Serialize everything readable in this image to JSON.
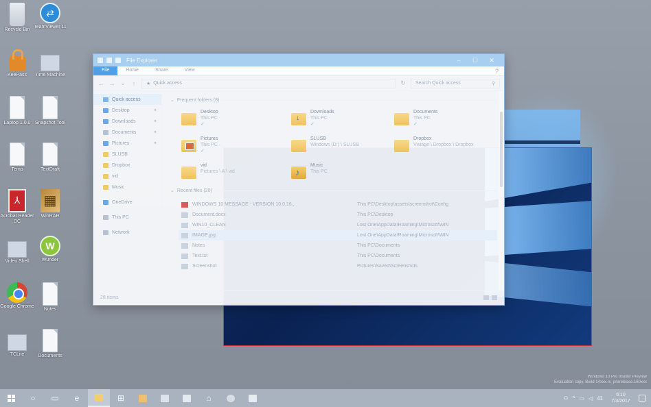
{
  "desktop": {
    "icons": [
      {
        "label": "Recycle Bin",
        "icon": "recycle-bin-icon"
      },
      {
        "label": "TeamViewer 11",
        "icon": "teamviewer-icon"
      },
      {
        "label": "KeePass",
        "icon": "lock-icon"
      },
      {
        "label": "Time Machine",
        "icon": "clock-icon"
      },
      {
        "label": "Laptop 1.0.0",
        "icon": "document-icon"
      },
      {
        "label": "Snapshot Tool",
        "icon": "document-icon"
      },
      {
        "label": "Temp",
        "icon": "document-icon"
      },
      {
        "label": "TextDraft",
        "icon": "document-icon"
      },
      {
        "label": "Acrobat Reader DC",
        "icon": "pdf-icon"
      },
      {
        "label": "WinRAR",
        "icon": "winrar-icon"
      },
      {
        "label": "Video Shell",
        "icon": "video-icon"
      },
      {
        "label": "Wunder",
        "icon": "green-app-icon"
      },
      {
        "label": "Google Chrome",
        "icon": "chrome-icon"
      },
      {
        "label": "Notes",
        "icon": "document-icon"
      },
      {
        "label": "TCLite",
        "icon": "document-icon"
      },
      {
        "label": "Documents",
        "icon": "document-icon"
      }
    ]
  },
  "explorer": {
    "title": "File Explorer",
    "tabs": [
      "File",
      "Home",
      "Share",
      "View"
    ],
    "address": "Quick access",
    "search_placeholder": "Search Quick access",
    "nav": [
      {
        "label": "Quick access",
        "icon": "star-icon",
        "selected": true
      },
      {
        "label": "Desktop",
        "icon": "folder-icon",
        "pinned": true
      },
      {
        "label": "Downloads",
        "icon": "download-icon",
        "pinned": true
      },
      {
        "label": "Documents",
        "icon": "folder-icon",
        "pinned": true
      },
      {
        "label": "Pictures",
        "icon": "folder-icon",
        "pinned": true
      },
      {
        "label": "SLUSB",
        "icon": "folder-icon"
      },
      {
        "label": "Dropbox",
        "icon": "folder-icon"
      },
      {
        "label": "vid",
        "icon": "folder-icon"
      },
      {
        "label": "Music",
        "icon": "folder-icon"
      },
      {
        "label": "OneDrive",
        "icon": "cloud-icon"
      },
      {
        "label": "This PC",
        "icon": "pc-icon"
      },
      {
        "label": "Network",
        "icon": "network-icon"
      }
    ],
    "frequent_header": "Frequent folders (8)",
    "frequent": [
      {
        "name": "Desktop",
        "sub": "This PC",
        "kind": "plain"
      },
      {
        "name": "Downloads",
        "sub": "This PC",
        "kind": "dl"
      },
      {
        "name": "Documents",
        "sub": "This PC",
        "kind": "plain"
      },
      {
        "name": "Pictures",
        "sub": "This PC",
        "kind": "pic"
      },
      {
        "name": "SLUSB",
        "sub": "Windows (D:) \\ SLUSB",
        "kind": "plain"
      },
      {
        "name": "Dropbox",
        "sub": "Vwiage \\ Dropbox \\ Dropbox",
        "kind": "plain"
      },
      {
        "name": "vid",
        "sub": "Pictures \\ A \\ vid",
        "kind": "plain"
      },
      {
        "name": "Music",
        "sub": "This PC",
        "kind": "music"
      }
    ],
    "recent_header": "Recent files (20)",
    "recent": [
      {
        "name": "WINDOWS 10 MESSAGE - VERSION 10.0.16...",
        "path": "This PC\\Desktop\\assets\\screenshot\\Config"
      },
      {
        "name": "Document.docx",
        "path": "This PC\\Desktop"
      },
      {
        "name": "WIN10_CLEAN",
        "path": "Lost One\\AppData\\Roaming\\Microsoft\\WIN"
      },
      {
        "name": "IMAGE.jpg",
        "path": "Lost One\\AppData\\Roaming\\Microsoft\\WIN"
      },
      {
        "name": "Notes",
        "path": "This PC\\Documents"
      },
      {
        "name": "Text.txt",
        "path": "This PC\\Documents"
      },
      {
        "name": "Screenshot",
        "path": "Pictures\\Saved\\Screenshots"
      }
    ],
    "status": "28 items"
  },
  "taskbar": {
    "clock_time": "6:10",
    "clock_date": "7/3/2017",
    "lang": "41"
  },
  "watermark": {
    "line1": "Windows 10 Pro Insider Preview",
    "line2": "Evaluation copy. Build 14xxx.rs_prerelease.160xxx"
  }
}
